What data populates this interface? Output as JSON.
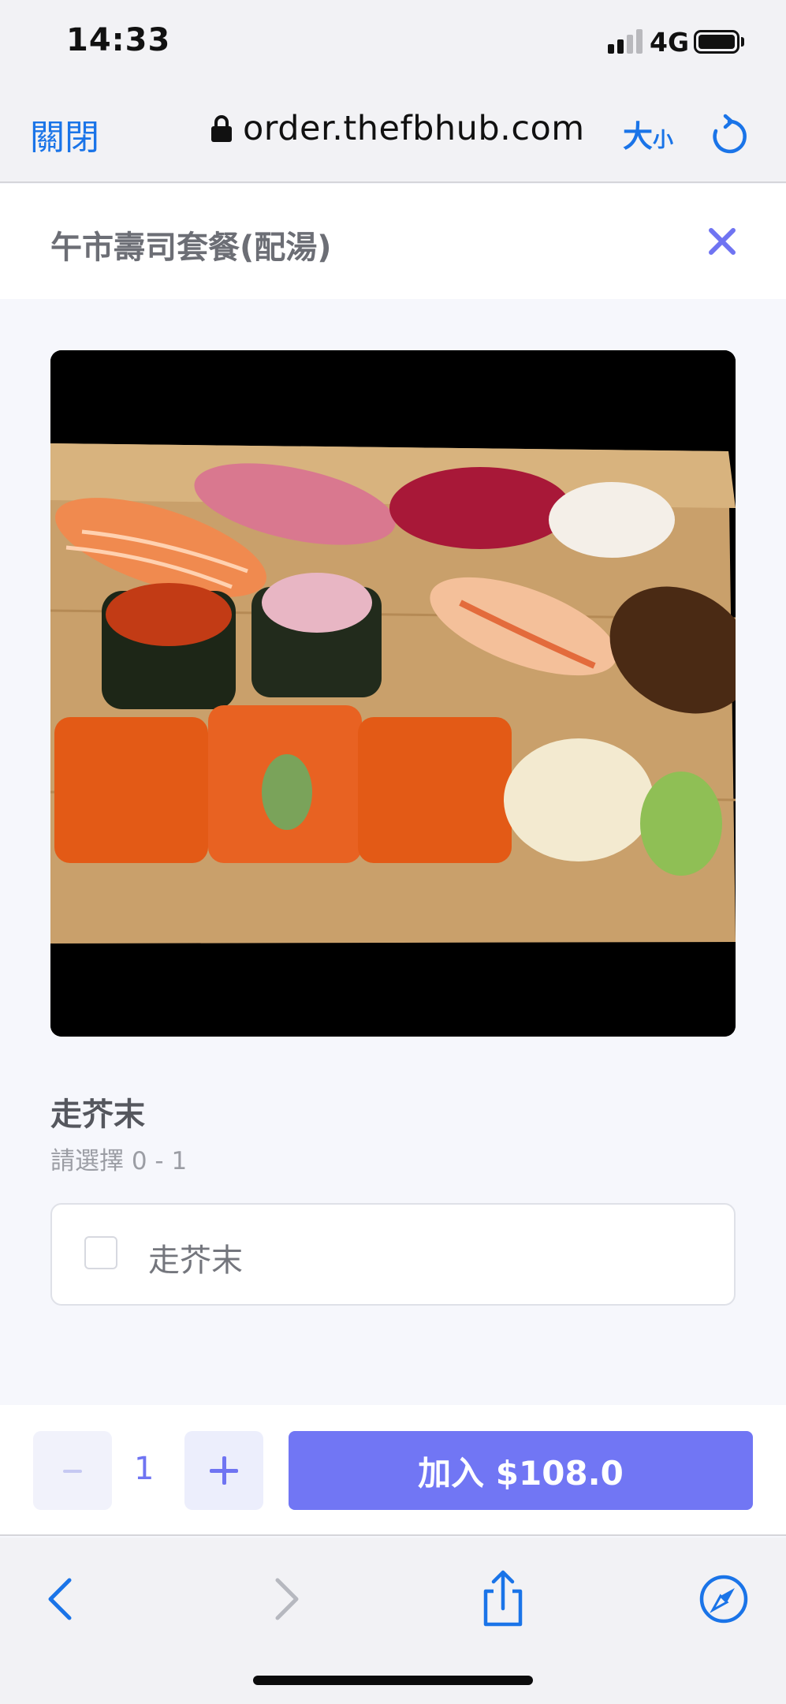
{
  "status_bar": {
    "time": "14:33",
    "network": "4G",
    "icons": [
      "signal-icon",
      "battery-icon"
    ]
  },
  "browser": {
    "close_label": "關閉",
    "url": "order.thefbhub.com",
    "text_size_big": "大",
    "text_size_small": "小",
    "icons": [
      "lock-icon",
      "reload-icon"
    ]
  },
  "modal": {
    "title": "午市壽司套餐(配湯)",
    "close_icon": "close-icon"
  },
  "option_group": {
    "title": "走芥末",
    "subtitle": "請選擇 0 - 1",
    "options": [
      {
        "label": "走芥末",
        "checked": false
      }
    ]
  },
  "order": {
    "minus_label": "-",
    "quantity": "1",
    "add_label": "加入 $108.0",
    "accent_color": "#7176f4"
  },
  "toolbar": {
    "icons": [
      "back-icon",
      "forward-icon",
      "share-icon",
      "compass-icon"
    ]
  }
}
